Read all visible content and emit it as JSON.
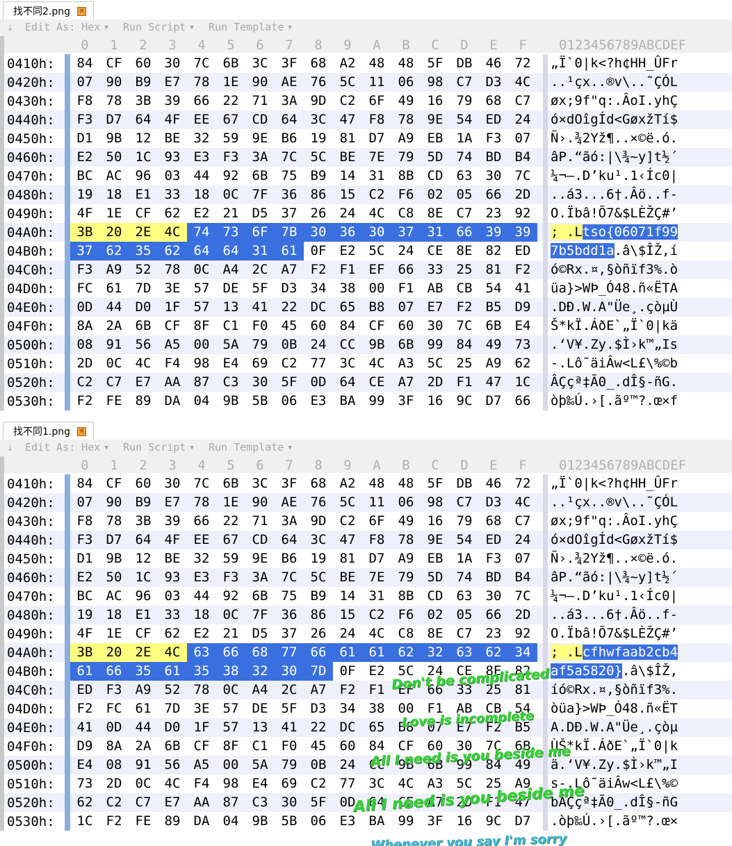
{
  "panes": [
    {
      "tab_title": "找不同2.png",
      "toolbar": {
        "edit_as": "Edit As: Hex",
        "run_script": "Run Script",
        "run_template": "Run Template"
      },
      "hex_columns": [
        "0",
        "1",
        "2",
        "3",
        "4",
        "5",
        "6",
        "7",
        "8",
        "9",
        "A",
        "B",
        "C",
        "D",
        "E",
        "F"
      ],
      "ascii_header": "0123456789ABCDEF",
      "rows": [
        {
          "addr": "0410h:",
          "bytes": [
            "84",
            "CF",
            "60",
            "30",
            "7C",
            "6B",
            "3C",
            "3F",
            "68",
            "A2",
            "48",
            "48",
            "5F",
            "DB",
            "46",
            "72"
          ],
          "ascii": "„Ï`0|k<?h¢HH_ÛFr"
        },
        {
          "addr": "0420h:",
          "bytes": [
            "07",
            "90",
            "B9",
            "E7",
            "78",
            "1E",
            "90",
            "AE",
            "76",
            "5C",
            "11",
            "06",
            "98",
            "C7",
            "D3",
            "4C"
          ],
          "ascii": "..¹çx..®v\\..˜ÇÓL"
        },
        {
          "addr": "0430h:",
          "bytes": [
            "F8",
            "78",
            "3B",
            "39",
            "66",
            "22",
            "71",
            "3A",
            "9D",
            "C2",
            "6F",
            "49",
            "16",
            "79",
            "68",
            "C7"
          ],
          "ascii": "øx;9f\"q:.ÂoI.yhÇ"
        },
        {
          "addr": "0440h:",
          "bytes": [
            "F3",
            "D7",
            "64",
            "4F",
            "EE",
            "67",
            "CD",
            "64",
            "3C",
            "47",
            "F8",
            "78",
            "9E",
            "54",
            "ED",
            "24"
          ],
          "ascii": "ó×dOîgÍd<GøxžTí$"
        },
        {
          "addr": "0450h:",
          "bytes": [
            "D1",
            "9B",
            "12",
            "BE",
            "32",
            "59",
            "9E",
            "B6",
            "19",
            "81",
            "D7",
            "A9",
            "EB",
            "1A",
            "F3",
            "07"
          ],
          "ascii": "Ñ›.¾2Yž¶..×©ë.ó."
        },
        {
          "addr": "0460h:",
          "bytes": [
            "E2",
            "50",
            "1C",
            "93",
            "E3",
            "F3",
            "3A",
            "7C",
            "5C",
            "BE",
            "7E",
            "79",
            "5D",
            "74",
            "BD",
            "B4"
          ],
          "ascii": "âP.“ãó:|\\¾~y]t½´"
        },
        {
          "addr": "0470h:",
          "bytes": [
            "BC",
            "AC",
            "96",
            "03",
            "44",
            "92",
            "6B",
            "75",
            "B9",
            "14",
            "31",
            "8B",
            "CD",
            "63",
            "30",
            "7C"
          ],
          "ascii": "¼¬–.D’ku¹.1‹Íc0|"
        },
        {
          "addr": "0480h:",
          "bytes": [
            "19",
            "18",
            "E1",
            "33",
            "18",
            "0C",
            "7F",
            "36",
            "86",
            "15",
            "C2",
            "F6",
            "02",
            "05",
            "66",
            "2D"
          ],
          "ascii": "..á3...6†.Âö..f-"
        },
        {
          "addr": "0490h:",
          "bytes": [
            "4F",
            "1E",
            "CF",
            "62",
            "E2",
            "21",
            "D5",
            "37",
            "26",
            "24",
            "4C",
            "C8",
            "8E",
            "C7",
            "23",
            "92"
          ],
          "ascii": "O.Ïbâ!Õ7&$LÈŽÇ#’"
        },
        {
          "addr": "04A0h:",
          "bytes": [
            "3B",
            "20",
            "2E",
            "4C",
            "74",
            "73",
            "6F",
            "7B",
            "30",
            "36",
            "30",
            "37",
            "31",
            "66",
            "39",
            "39"
          ],
          "ascii": "; .Ltso{06071f99"
        },
        {
          "addr": "04B0h:",
          "bytes": [
            "37",
            "62",
            "35",
            "62",
            "64",
            "64",
            "31",
            "61",
            "0F",
            "E2",
            "5C",
            "24",
            "CE",
            "8E",
            "82",
            "ED"
          ],
          "ascii": "7b5bdd1a.â\\$ÎŽ‚í"
        },
        {
          "addr": "04C0h:",
          "bytes": [
            "F3",
            "A9",
            "52",
            "78",
            "0C",
            "A4",
            "2C",
            "A7",
            "F2",
            "F1",
            "EF",
            "66",
            "33",
            "25",
            "81",
            "F2"
          ],
          "ascii": "ó©Rx.¤,§òñïf3%.ò"
        },
        {
          "addr": "04D0h:",
          "bytes": [
            "FC",
            "61",
            "7D",
            "3E",
            "57",
            "DE",
            "5F",
            "D3",
            "34",
            "38",
            "00",
            "F1",
            "AB",
            "CB",
            "54",
            "41"
          ],
          "ascii": "üa}>WÞ_Ó48.ñ«ËTA"
        },
        {
          "addr": "04E0h:",
          "bytes": [
            "0D",
            "44",
            "D0",
            "1F",
            "57",
            "13",
            "41",
            "22",
            "DC",
            "65",
            "B8",
            "07",
            "E7",
            "F2",
            "B5",
            "D9"
          ],
          "ascii": ".DÐ.W.A\"Üe¸.çòµÙ"
        },
        {
          "addr": "04F0h:",
          "bytes": [
            "8A",
            "2A",
            "6B",
            "CF",
            "8F",
            "C1",
            "F0",
            "45",
            "60",
            "84",
            "CF",
            "60",
            "30",
            "7C",
            "6B",
            "E4"
          ],
          "ascii": "Š*kÏ.ÁðE`„Ï`0|kä"
        },
        {
          "addr": "0500h:",
          "bytes": [
            "08",
            "91",
            "56",
            "A5",
            "00",
            "5A",
            "79",
            "0B",
            "24",
            "CC",
            "9B",
            "6B",
            "99",
            "84",
            "49",
            "73"
          ],
          "ascii": ".‘V¥.Zy.$Ì›k™„Is"
        },
        {
          "addr": "0510h:",
          "bytes": [
            "2D",
            "0C",
            "4C",
            "F4",
            "98",
            "E4",
            "69",
            "C2",
            "77",
            "3C",
            "4C",
            "A3",
            "5C",
            "25",
            "A9",
            "62"
          ],
          "ascii": "-.Lô˜äiÂw<L£\\%©b"
        },
        {
          "addr": "0520h:",
          "bytes": [
            "C2",
            "C7",
            "E7",
            "AA",
            "87",
            "C3",
            "30",
            "5F",
            "0D",
            "64",
            "CE",
            "A7",
            "2D",
            "F1",
            "47",
            "1C"
          ],
          "ascii": "ÂÇçª‡Ã0_.dÎ§-ñG."
        },
        {
          "addr": "0530h:",
          "bytes": [
            "F2",
            "FE",
            "89",
            "DA",
            "04",
            "9B",
            "5B",
            "06",
            "E3",
            "BA",
            "99",
            "3F",
            "16",
            "9C",
            "D7",
            "66"
          ],
          "ascii": "òþ‰Ú.›[.ãº™?.œ×f"
        }
      ],
      "selection": {
        "text": "tso{06071f997b5bdd1a"
      }
    },
    {
      "tab_title": "找不同1.png",
      "toolbar": {
        "edit_as": "Edit As: Hex",
        "run_script": "Run Script",
        "run_template": "Run Template"
      },
      "hex_columns": [
        "0",
        "1",
        "2",
        "3",
        "4",
        "5",
        "6",
        "7",
        "8",
        "9",
        "A",
        "B",
        "C",
        "D",
        "E",
        "F"
      ],
      "ascii_header": "0123456789ABCDEF",
      "rows": [
        {
          "addr": "0410h:",
          "bytes": [
            "84",
            "CF",
            "60",
            "30",
            "7C",
            "6B",
            "3C",
            "3F",
            "68",
            "A2",
            "48",
            "48",
            "5F",
            "DB",
            "46",
            "72"
          ],
          "ascii": "„Ï`0|k<?h¢HH_ÛFr"
        },
        {
          "addr": "0420h:",
          "bytes": [
            "07",
            "90",
            "B9",
            "E7",
            "78",
            "1E",
            "90",
            "AE",
            "76",
            "5C",
            "11",
            "06",
            "98",
            "C7",
            "D3",
            "4C"
          ],
          "ascii": "..¹çx..®v\\..˜ÇÓL"
        },
        {
          "addr": "0430h:",
          "bytes": [
            "F8",
            "78",
            "3B",
            "39",
            "66",
            "22",
            "71",
            "3A",
            "9D",
            "C2",
            "6F",
            "49",
            "16",
            "79",
            "68",
            "C7"
          ],
          "ascii": "øx;9f\"q:.ÂoI.yhÇ"
        },
        {
          "addr": "0440h:",
          "bytes": [
            "F3",
            "D7",
            "64",
            "4F",
            "EE",
            "67",
            "CD",
            "64",
            "3C",
            "47",
            "F8",
            "78",
            "9E",
            "54",
            "ED",
            "24"
          ],
          "ascii": "ó×dOîgÍd<GøxžTí$"
        },
        {
          "addr": "0450h:",
          "bytes": [
            "D1",
            "9B",
            "12",
            "BE",
            "32",
            "59",
            "9E",
            "B6",
            "19",
            "81",
            "D7",
            "A9",
            "EB",
            "1A",
            "F3",
            "07"
          ],
          "ascii": "Ñ›.¾2Yž¶..×©ë.ó."
        },
        {
          "addr": "0460h:",
          "bytes": [
            "E2",
            "50",
            "1C",
            "93",
            "E3",
            "F3",
            "3A",
            "7C",
            "5C",
            "BE",
            "7E",
            "79",
            "5D",
            "74",
            "BD",
            "B4"
          ],
          "ascii": "âP.“ãó:|\\¾~y]t½´"
        },
        {
          "addr": "0470h:",
          "bytes": [
            "BC",
            "AC",
            "96",
            "03",
            "44",
            "92",
            "6B",
            "75",
            "B9",
            "14",
            "31",
            "8B",
            "CD",
            "63",
            "30",
            "7C"
          ],
          "ascii": "¼¬–.D’ku¹.1‹Íc0|"
        },
        {
          "addr": "0480h:",
          "bytes": [
            "19",
            "18",
            "E1",
            "33",
            "18",
            "0C",
            "7F",
            "36",
            "86",
            "15",
            "C2",
            "F6",
            "02",
            "05",
            "66",
            "2D"
          ],
          "ascii": "..á3...6†.Âö..f-"
        },
        {
          "addr": "0490h:",
          "bytes": [
            "4F",
            "1E",
            "CF",
            "62",
            "E2",
            "21",
            "D5",
            "37",
            "26",
            "24",
            "4C",
            "C8",
            "8E",
            "C7",
            "23",
            "92"
          ],
          "ascii": "O.Ïbâ!Õ7&$LÈŽÇ#’"
        },
        {
          "addr": "04A0h:",
          "bytes": [
            "3B",
            "20",
            "2E",
            "4C",
            "63",
            "66",
            "68",
            "77",
            "66",
            "61",
            "61",
            "62",
            "32",
            "63",
            "62",
            "34"
          ],
          "ascii": "; .Lcfhwfaab2cb4"
        },
        {
          "addr": "04B0h:",
          "bytes": [
            "61",
            "66",
            "35",
            "61",
            "35",
            "38",
            "32",
            "30",
            "7D",
            "0F",
            "E2",
            "5C",
            "24",
            "CE",
            "8E",
            "82"
          ],
          "ascii": "af5a5820}.â\\$ÎŽ‚"
        },
        {
          "addr": "04C0h:",
          "bytes": [
            "ED",
            "F3",
            "A9",
            "52",
            "78",
            "0C",
            "A4",
            "2C",
            "A7",
            "F2",
            "F1",
            "EF",
            "66",
            "33",
            "25",
            "81"
          ],
          "ascii": "íó©Rx.¤,§òñïf3%."
        },
        {
          "addr": "04D0h:",
          "bytes": [
            "F2",
            "FC",
            "61",
            "7D",
            "3E",
            "57",
            "DE",
            "5F",
            "D3",
            "34",
            "38",
            "00",
            "F1",
            "AB",
            "CB",
            "54"
          ],
          "ascii": "òüa}>WÞ_Ó48.ñ«ËT"
        },
        {
          "addr": "04E0h:",
          "bytes": [
            "41",
            "0D",
            "44",
            "D0",
            "1F",
            "57",
            "13",
            "41",
            "22",
            "DC",
            "65",
            "B8",
            "07",
            "E7",
            "F2",
            "B5"
          ],
          "ascii": "A.DÐ.W.A\"Üe¸.çòµ"
        },
        {
          "addr": "04F0h:",
          "bytes": [
            "D9",
            "8A",
            "2A",
            "6B",
            "CF",
            "8F",
            "C1",
            "F0",
            "45",
            "60",
            "84",
            "CF",
            "60",
            "30",
            "7C",
            "6B"
          ],
          "ascii": "ÙŠ*kÏ.ÁðE`„Ï`0|k"
        },
        {
          "addr": "0500h:",
          "bytes": [
            "E4",
            "08",
            "91",
            "56",
            "A5",
            "00",
            "5A",
            "79",
            "0B",
            "24",
            "CC",
            "9B",
            "6B",
            "99",
            "84",
            "49"
          ],
          "ascii": "ä.‘V¥.Zy.$Ì›k™„I"
        },
        {
          "addr": "0510h:",
          "bytes": [
            "73",
            "2D",
            "0C",
            "4C",
            "F4",
            "98",
            "E4",
            "69",
            "C2",
            "77",
            "3C",
            "4C",
            "A3",
            "5C",
            "25",
            "A9"
          ],
          "ascii": "s-.Lô˜äiÂw<L£\\%©"
        },
        {
          "addr": "0520h:",
          "bytes": [
            "62",
            "C2",
            "C7",
            "E7",
            "AA",
            "87",
            "C3",
            "30",
            "5F",
            "0D",
            "64",
            "CE",
            "A7",
            "2D",
            "F1",
            "47"
          ],
          "ascii": "bÂÇçª‡Ã0_.dÎ§-ñG"
        },
        {
          "addr": "0530h:",
          "bytes": [
            "1C",
            "F2",
            "FE",
            "89",
            "DA",
            "04",
            "9B",
            "5B",
            "06",
            "E3",
            "BA",
            "99",
            "3F",
            "16",
            "9C",
            "D7"
          ],
          "ascii": ".òþ‰Ú.›[.ãº™?.œ×"
        }
      ],
      "selection": {
        "text": "cfhwfaab2cb4af5a5820}"
      }
    }
  ],
  "lyrics": [
    {
      "text": "Don't be complicated",
      "color": "#2fd02f"
    },
    {
      "text": "Love is incomplete",
      "color": "#2fd02f"
    },
    {
      "text": "All I need is you beside me",
      "color": "#2fd02f"
    },
    {
      "text": "All I need is you beside me",
      "color": "#2fd02f"
    },
    {
      "text": "Whenever you say I'm sorry",
      "color": "#3ab0d8"
    }
  ],
  "colors": {
    "yellow_highlight": "#ffff80",
    "blue_highlight": "#3a6fe0",
    "alt_row": "#eef0fc",
    "toolbar_text": "#a8a8a8"
  }
}
